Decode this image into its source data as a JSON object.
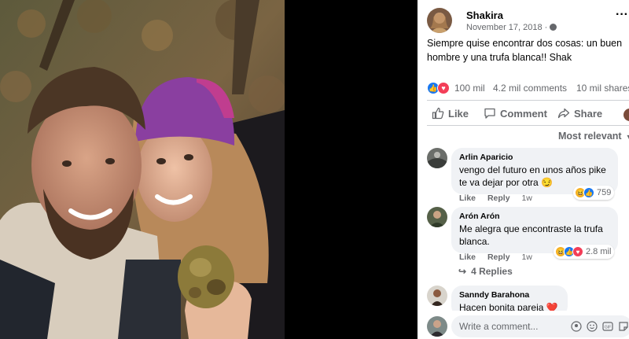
{
  "post": {
    "author": "Shakira",
    "date": "November 17, 2018 ·",
    "caption": "Siempre quise encontrar dos cosas: un buen hombre y una trufa blanca!! Shak"
  },
  "stats": {
    "reactions": "100 mil",
    "comments": "4.2 mil comments",
    "shares": "10 mil shares"
  },
  "actions": {
    "like": "Like",
    "comment": "Comment",
    "share": "Share"
  },
  "sort_label": "Most relevant",
  "comments": [
    {
      "name": "Arlin Aparicio",
      "text": "vengo del futuro en unos años pike te va dejar por otra 😏",
      "like": "Like",
      "reply": "Reply",
      "time": "1w",
      "reaction_count": "759"
    },
    {
      "name": "Arón Arón",
      "text": "Me alegra que encontraste la trufa blanca.",
      "like": "Like",
      "reply": "Reply",
      "time": "1w",
      "reaction_count": "2.8 mil"
    },
    {
      "name": "Sanndy Barahona",
      "text": "Hacen bonita pareja ❤️"
    }
  ],
  "replies_label": "4 Replies",
  "write_placeholder": "Write a comment...",
  "colors": {
    "like_blue": "#1877f2",
    "love_red": "#f33e58",
    "haha_yellow": "#f7b125",
    "secondary_text": "#65676b",
    "bubble_bg": "#f0f2f5"
  }
}
